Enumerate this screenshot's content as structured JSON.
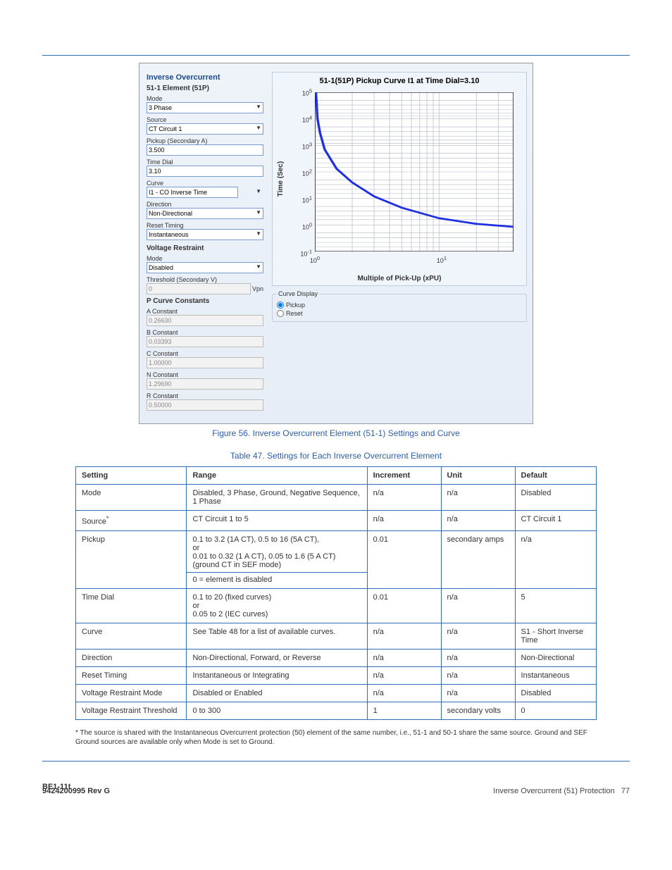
{
  "header_rule": true,
  "screenshot": {
    "heading": "Inverse Overcurrent",
    "element_title": "51-1 Element (51P)",
    "fields": {
      "mode": {
        "label": "Mode",
        "value": "3 Phase"
      },
      "source": {
        "label": "Source",
        "value": "CT Circuit 1"
      },
      "pickup": {
        "label": "Pickup (Secondary A)",
        "value": "3.500"
      },
      "time_dial": {
        "label": "Time Dial",
        "value": "3.10"
      },
      "curve": {
        "label": "Curve",
        "value": "I1 - CO Inverse Time"
      },
      "direction": {
        "label": "Direction",
        "value": "Non-Directional"
      },
      "reset_timing": {
        "label": "Reset Timing",
        "value": "Instantaneous"
      }
    },
    "voltage_restraint": {
      "heading": "Voltage Restraint",
      "mode": {
        "label": "Mode",
        "value": "Disabled"
      },
      "threshold": {
        "label": "Threshold (Secondary V)",
        "value": "0",
        "unit": "Vpn"
      }
    },
    "p_constants": {
      "heading": "P Curve Constants",
      "a": {
        "label": "A Constant",
        "value": "0.26630"
      },
      "b": {
        "label": "B Constant",
        "value": "0.03393"
      },
      "c": {
        "label": "C Constant",
        "value": "1.00000"
      },
      "n": {
        "label": "N Constant",
        "value": "1.29690"
      },
      "r": {
        "label": "R Constant",
        "value": "0.50000"
      }
    },
    "chart": {
      "title": "51-1(51P) Pickup Curve I1 at Time Dial=3.10",
      "ylabel": "Time (Sec)",
      "xlabel": "Multiple of Pick-Up (xPU)",
      "y_ticks": [
        "10^5",
        "10^4",
        "10^3",
        "10^2",
        "10^1",
        "10^0",
        "10^-1"
      ],
      "x_ticks": [
        "10^0",
        "10^1"
      ],
      "curve_display": {
        "legend": "Curve Display",
        "pickup": "Pickup",
        "reset": "Reset",
        "selected": "Pickup"
      }
    }
  },
  "figure_caption": "Figure 56. Inverse Overcurrent Element (51-1) Settings and Curve",
  "table_caption": "Table 47. Settings for Each Inverse Overcurrent Element",
  "table": {
    "headers": [
      "Setting",
      "Range",
      "Increment",
      "Unit",
      "Default"
    ],
    "rows": [
      {
        "setting": "Mode",
        "range": "Disabled, 3 Phase, Ground, Negative Sequence, 1 Phase",
        "inc": "n/a",
        "unit": "n/a",
        "def": "Disabled"
      },
      {
        "setting_html": "Source<sup>*</sup>",
        "range": "CT Circuit 1 to 5",
        "inc": "n/a",
        "unit": "n/a",
        "def": "CT Circuit 1"
      },
      {
        "setting": "Pickup",
        "range_html": "0.1 to 3.2 (1A CT), 0.5 to 16 (5A CT),<br>or<br>0.01 to 0.32 (1 A CT), 0.05 to 1.6 (5 A CT) (ground CT in SEF mode)<br><hr style='border:none;border-top:1px solid #2f6fb5;margin:4px -8px;' >0 = element is disabled",
        "inc": "0.01",
        "unit": "secondary amps",
        "def": "n/a"
      },
      {
        "setting": "Time Dial",
        "range_html": "0.1 to 20 (fixed curves)<br>or<br>0.05 to 2 (IEC curves)",
        "inc": "0.01",
        "unit": "n/a",
        "def": "5"
      },
      {
        "setting": "Curve",
        "range": "See Table 48 for a list of available curves.",
        "inc": "n/a",
        "unit": "n/a",
        "def": "S1 - Short Inverse Time"
      },
      {
        "setting": "Direction",
        "range": "Non-Directional, Forward, or Reverse",
        "inc": "n/a",
        "unit": "n/a",
        "def": "Non-Directional"
      },
      {
        "setting": "Reset Timing",
        "range": "Instantaneous or Integrating",
        "inc": "n/a",
        "unit": "n/a",
        "def": "Instantaneous"
      },
      {
        "setting": "Voltage Restraint Mode",
        "range": "Disabled or Enabled",
        "inc": "n/a",
        "unit": "n/a",
        "def": "Disabled"
      },
      {
        "setting": "Voltage Restraint Threshold",
        "range": "0 to 300",
        "inc": "1",
        "unit": "secondary volts",
        "def": "0"
      }
    ],
    "footnote_html": "* The source is shared with the Instantaneous Overcurrent protection (50) element of the same number, i.e., 51-1 and 50-1 share the same source. Ground and SEF Ground sources are available only when Mode is set to Ground."
  },
  "footer": {
    "left": "BE1-11t",
    "right": "Inverse Overcurrent (51) Protection",
    "page": "77",
    "doc": "9424200995 Rev G"
  },
  "chart_data": {
    "type": "line",
    "title": "51-1(51P) Pickup Curve I1 at Time Dial=3.10",
    "xlabel": "Multiple of Pick-Up (xPU)",
    "ylabel": "Time (Sec)",
    "x_scale": "log",
    "y_scale": "log",
    "xlim": [
      1,
      40
    ],
    "ylim": [
      0.1,
      100000
    ],
    "series": [
      {
        "name": "Pickup Curve I1 TD=3.10",
        "x": [
          1.02,
          1.05,
          1.1,
          1.2,
          1.5,
          2,
          3,
          5,
          10,
          20,
          40
        ],
        "y": [
          100000,
          10000,
          3000,
          700,
          130,
          40,
          12,
          4.5,
          1.8,
          1.1,
          0.85
        ]
      }
    ]
  }
}
